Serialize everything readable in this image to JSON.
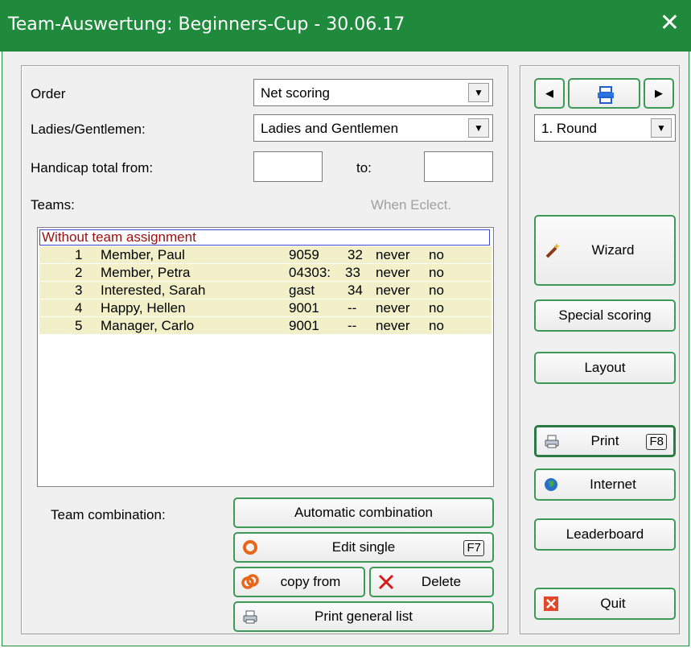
{
  "window": {
    "title": "Team-Auswertung: Beginners-Cup - 30.06.17",
    "close_glyph": "✕"
  },
  "form": {
    "order_label": "Order",
    "order_value": "Net scoring",
    "gender_label": "Ladies/Gentlemen:",
    "gender_value": "Ladies and Gentlemen",
    "handicap_label": "Handicap total from:",
    "handicap_from": "",
    "to_label": "to:",
    "handicap_to": "",
    "teams_label": "Teams:",
    "when_eclect_label": "When Eclect."
  },
  "list": {
    "header": "Without team assignment",
    "rows": [
      {
        "num": "1",
        "name": "Member, Paul",
        "id": "9059",
        "hcp": "32",
        "when": "never",
        "flag": "no"
      },
      {
        "num": "2",
        "name": "Member, Petra",
        "id": "04303:",
        "hcp": "33",
        "when": "never",
        "flag": "no"
      },
      {
        "num": "3",
        "name": "Interested, Sarah",
        "id": "gast",
        "hcp": "34",
        "when": "never",
        "flag": "no"
      },
      {
        "num": "4",
        "name": "Happy, Hellen",
        "id": "9001",
        "hcp": "--",
        "when": "never",
        "flag": "no"
      },
      {
        "num": "5",
        "name": "Manager, Carlo",
        "id": "9001",
        "hcp": "--",
        "when": "never",
        "flag": "no"
      }
    ]
  },
  "bottom": {
    "combination_label": "Team combination:",
    "automatic": "Automatic combination",
    "edit_single": "Edit single",
    "edit_key": "F7",
    "copy_from": "copy from",
    "delete": "Delete",
    "print_general": "Print general list"
  },
  "right": {
    "round_value": "1. Round",
    "wizard": "Wizard",
    "special": "Special scoring",
    "layout": "Layout",
    "print": "Print",
    "print_key": "F8",
    "internet": "Internet",
    "leaderboard": "Leaderboard",
    "quit": "Quit"
  },
  "colors": {
    "titlebar": "#1f8a3c",
    "button_border": "#3d9a56",
    "row_bg": "#f2f0c8",
    "header_text": "#a01010"
  }
}
